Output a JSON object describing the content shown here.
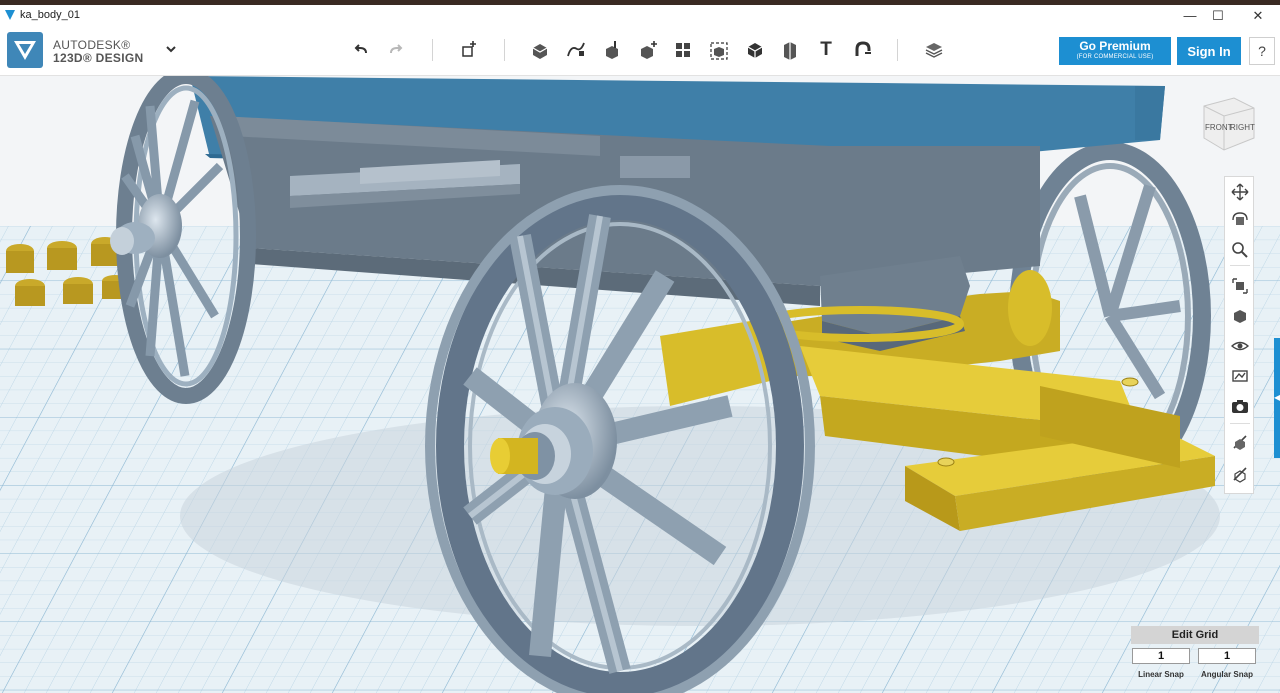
{
  "window": {
    "title": "ka_body_01",
    "controls": [
      "minimize",
      "maximize",
      "close"
    ],
    "minimize_glyph": "—",
    "maximize_glyph": "☐",
    "close_glyph": "✕"
  },
  "app": {
    "brand_line1": "AUTODESK®",
    "brand_line2": "123D® DESIGN",
    "logo_icon": "autodesk-123d-logo"
  },
  "toolbar": {
    "tools": [
      {
        "name": "undo",
        "icon": "undo-icon"
      },
      {
        "name": "redo",
        "icon": "redo-icon"
      },
      {
        "name": "transform",
        "icon": "transform-icon"
      },
      {
        "name": "primitives",
        "icon": "primitives-icon"
      },
      {
        "name": "sketch",
        "icon": "sketch-icon"
      },
      {
        "name": "construct",
        "icon": "construct-icon"
      },
      {
        "name": "modify",
        "icon": "modify-icon"
      },
      {
        "name": "pattern",
        "icon": "pattern-icon"
      },
      {
        "name": "grouping",
        "icon": "grouping-icon"
      },
      {
        "name": "combine",
        "icon": "combine-icon"
      },
      {
        "name": "measure",
        "icon": "measure-icon"
      },
      {
        "name": "text",
        "icon": "text-icon"
      },
      {
        "name": "snap",
        "icon": "snap-icon"
      },
      {
        "name": "material",
        "icon": "material-icon"
      }
    ],
    "text_tool_glyph": "T",
    "premium_label": "Go Premium",
    "premium_sublabel": "(FOR COMMERCIAL USE)",
    "signin_label": "Sign In",
    "help_label": "?"
  },
  "viewcube": {
    "front_label": "FRONT",
    "right_label": "RIGHT"
  },
  "navbar": {
    "tools": [
      "pan-icon",
      "orbit-icon",
      "zoom-icon",
      "fit-icon",
      "view-icon",
      "visibility-icon",
      "material-view-icon",
      "screenshot-icon",
      "hide-icon",
      "show-icon"
    ]
  },
  "grid": {
    "edit_label": "Edit Grid",
    "linear_snap_value": "1",
    "angular_snap_value": "1",
    "linear_snap_label": "Linear Snap",
    "angular_snap_label": "Angular Snap"
  },
  "colors": {
    "accent": "#1d8fd2",
    "body_blue": "#3f7fa8",
    "steel": "#8ea0b0",
    "chassis_yellow": "#d8bd2a",
    "grid_bg": "#e8f1f6"
  }
}
